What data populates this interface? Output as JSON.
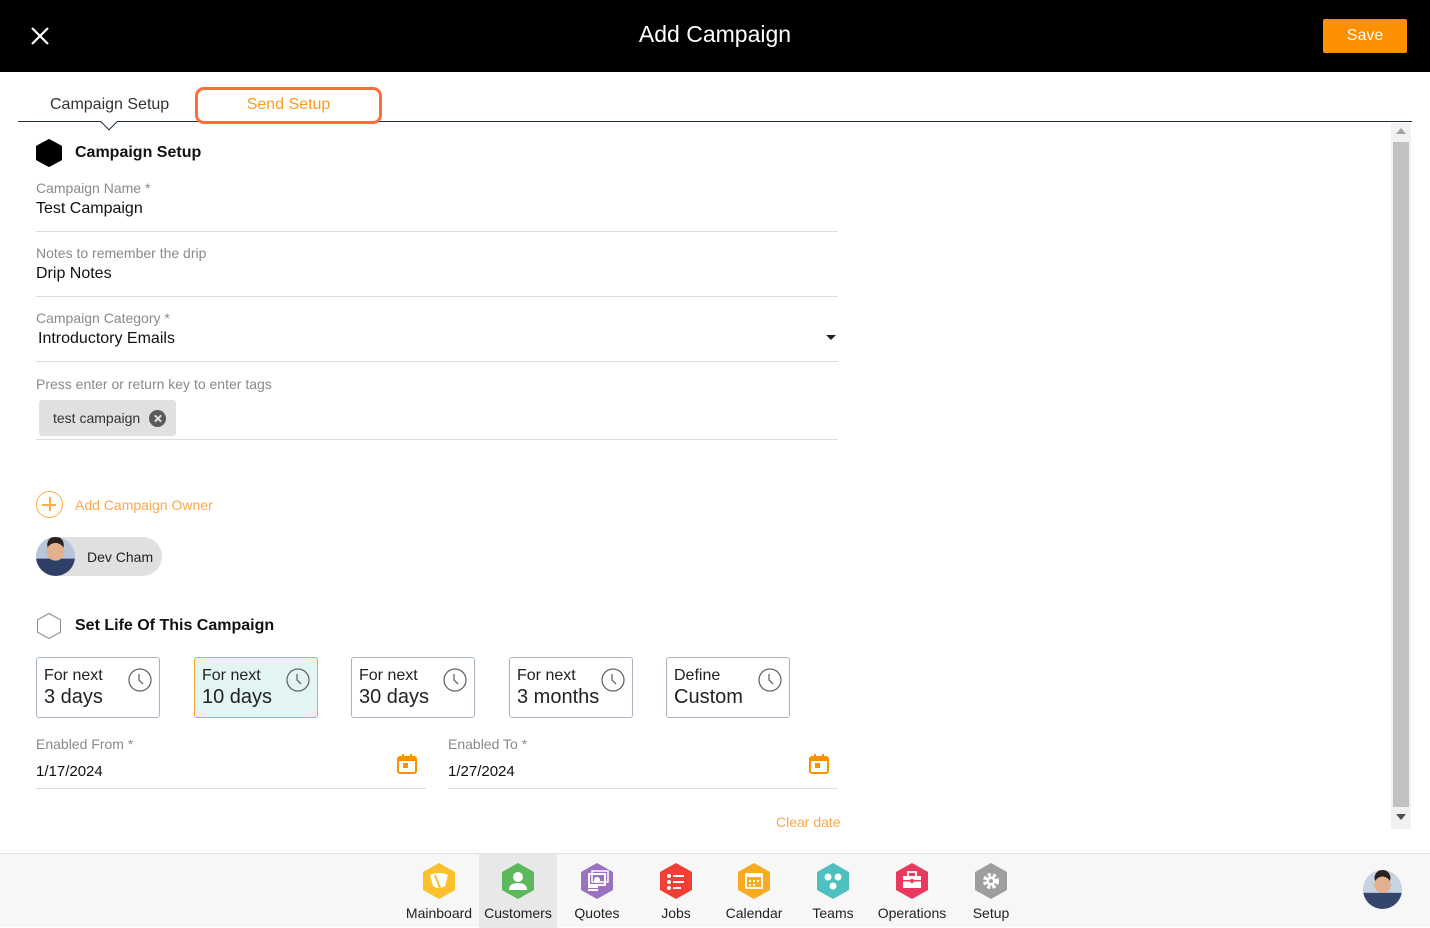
{
  "header": {
    "title": "Add Campaign",
    "save_label": "Save",
    "close_icon": "close-icon"
  },
  "tabs": [
    {
      "label": "Campaign Setup",
      "active": true
    },
    {
      "label": "Send Setup",
      "active": false,
      "highlighted": true
    }
  ],
  "campaign_setup": {
    "heading": "Campaign Setup",
    "fields": {
      "campaign_name": {
        "label": "Campaign Name *",
        "value": "Test Campaign"
      },
      "notes": {
        "label": "Notes to remember the drip",
        "value": "Drip Notes"
      },
      "category": {
        "label": "Campaign Category *",
        "value": "Introductory Emails"
      },
      "tags": {
        "label": "Press enter or return key to enter tags",
        "values": [
          "test campaign"
        ]
      }
    },
    "add_owner_label": "Add Campaign Owner",
    "owners": [
      {
        "name": "Dev Cham"
      }
    ]
  },
  "life": {
    "heading": "Set Life Of This Campaign",
    "options": [
      {
        "line1": "For next",
        "line2": "3 days",
        "selected": false
      },
      {
        "line1": "For next",
        "line2": "10 days",
        "selected": true
      },
      {
        "line1": "For next",
        "line2": "30 days",
        "selected": false
      },
      {
        "line1": "For next",
        "line2": "3 months",
        "selected": false
      },
      {
        "line1": "Define",
        "line2": "Custom",
        "selected": false
      }
    ],
    "enabled_from": {
      "label": "Enabled From *",
      "value": "1/17/2024"
    },
    "enabled_to": {
      "label": "Enabled To *",
      "value": "1/27/2024"
    },
    "clear_date_label": "Clear date"
  },
  "bottom_nav": {
    "items": [
      {
        "label": "Mainboard",
        "icon": "mainboard-icon",
        "color": "#fbc02d",
        "active": false
      },
      {
        "label": "Customers",
        "icon": "customer-icon",
        "color": "#5cb85c",
        "active": true
      },
      {
        "label": "Quotes",
        "icon": "quotes-icon",
        "color": "#9a72c0",
        "active": false
      },
      {
        "label": "Jobs",
        "icon": "jobs-icon",
        "color": "#ef3f36",
        "active": false
      },
      {
        "label": "Calendar",
        "icon": "calendar-icon",
        "color": "#f9aa23",
        "active": false
      },
      {
        "label": "Teams",
        "icon": "teams-icon",
        "color": "#4fc0c0",
        "active": false
      },
      {
        "label": "Operations",
        "icon": "operations-icon",
        "color": "#e83a5e",
        "active": false
      },
      {
        "label": "Setup",
        "icon": "setup-icon",
        "color": "#9e9e9e",
        "active": false
      }
    ]
  },
  "colors": {
    "accent": "#fb9000",
    "link": "#fba84a",
    "tab_highlight_border": "#ff6c3b",
    "selected_card_bg": "#e2f4f4"
  }
}
